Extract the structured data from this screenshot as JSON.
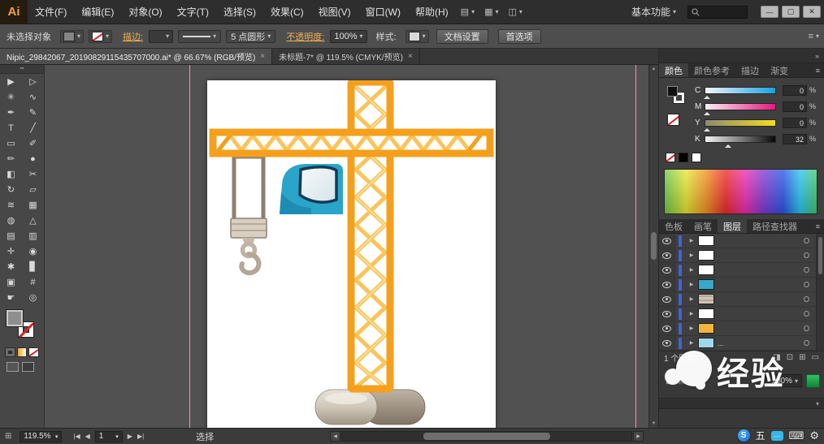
{
  "colors": {
    "accent_orange": "#F4A01C",
    "lattice_yellow": "#FAC45B",
    "cab_blue": "#2AA4C9",
    "hook_brown": "#8E8070",
    "guide_pink": "#EF93A6",
    "layer_bar_blue": "#3F63D8"
  },
  "menubar": {
    "logo": "Ai",
    "menus": [
      "文件(F)",
      "编辑(E)",
      "对象(O)",
      "文字(T)",
      "选择(S)",
      "效果(C)",
      "视图(V)",
      "窗口(W)",
      "帮助(H)"
    ],
    "workspace": "基本功能",
    "window_buttons": {
      "minimize": "—",
      "restore": "▢",
      "close": "✕"
    }
  },
  "controlbar": {
    "no_selection": "未选择对象",
    "stroke_label": "描边:",
    "stroke_value": "",
    "brush_name": "5 点圆形",
    "opacity_label": "不透明度:",
    "opacity_value": "100%",
    "style_label": "样式:",
    "doc_setup_button": "文档设置",
    "preferences_button": "首选项"
  },
  "tabbar": {
    "tabs": [
      {
        "title": "Nipic_29842067_20190829115435707000.ai* @ 66.67% (RGB/预览)",
        "close": "×"
      },
      {
        "title": "未标题-7* @ 119.5% (CMYK/预览)",
        "close": "×"
      }
    ]
  },
  "toolbar": {
    "tools": [
      {
        "name": "selection",
        "glyph": "▶"
      },
      {
        "name": "direct-selection",
        "glyph": "▷"
      },
      {
        "name": "magic-wand",
        "glyph": "✳"
      },
      {
        "name": "lasso",
        "glyph": "∿"
      },
      {
        "name": "pen",
        "glyph": "✒"
      },
      {
        "name": "curvature",
        "glyph": "✎"
      },
      {
        "name": "type",
        "glyph": "T"
      },
      {
        "name": "line-segment",
        "glyph": "╱"
      },
      {
        "name": "rectangle",
        "glyph": "▭"
      },
      {
        "name": "paintbrush",
        "glyph": "✐"
      },
      {
        "name": "pencil",
        "glyph": "✏"
      },
      {
        "name": "blob-brush",
        "glyph": "●"
      },
      {
        "name": "eraser",
        "glyph": "◧"
      },
      {
        "name": "scissors",
        "glyph": "✂"
      },
      {
        "name": "rotate",
        "glyph": "↻"
      },
      {
        "name": "scale",
        "glyph": "▱"
      },
      {
        "name": "width",
        "glyph": "≋"
      },
      {
        "name": "free-transform",
        "glyph": "▦"
      },
      {
        "name": "shape-builder",
        "glyph": "◍"
      },
      {
        "name": "perspective-grid",
        "glyph": "△"
      },
      {
        "name": "mesh",
        "glyph": "▤"
      },
      {
        "name": "gradient",
        "glyph": "▥"
      },
      {
        "name": "eyedropper",
        "glyph": "✛"
      },
      {
        "name": "blend",
        "glyph": "◉"
      },
      {
        "name": "symbol-sprayer",
        "glyph": "✱"
      },
      {
        "name": "column-graph",
        "glyph": "▊"
      },
      {
        "name": "artboard",
        "glyph": "▣"
      },
      {
        "name": "slice",
        "glyph": "#"
      },
      {
        "name": "hand",
        "glyph": "☛"
      },
      {
        "name": "zoom",
        "glyph": "◎"
      }
    ]
  },
  "color_panel": {
    "tabs": [
      "颜色",
      "颜色参考",
      "描边",
      "渐变"
    ],
    "channels": [
      {
        "label": "C",
        "value": "0"
      },
      {
        "label": "M",
        "value": "0"
      },
      {
        "label": "Y",
        "value": "0"
      },
      {
        "label": "K",
        "value": "32"
      }
    ],
    "percent": "%"
  },
  "layers_panel": {
    "tabs": [
      "色板",
      "画笔",
      "图层",
      "路径查找器"
    ],
    "rows": [
      {
        "thumb_style": "background:#ffffff"
      },
      {
        "thumb_style": "background:#ffffff"
      },
      {
        "thumb_style": "background:#ffffff"
      },
      {
        "thumb_style": "background:#35a9c9"
      },
      {
        "thumb_style": "background:repeating-linear-gradient(0deg,#cfc5b6 0 3px,#b2a795 3px 5px)"
      },
      {
        "thumb_style": "background:#ffffff"
      },
      {
        "thumb_style": "background:#f2b63a"
      },
      {
        "thumb_style": "background:#9fd8e8",
        "label": "..."
      }
    ],
    "footer": "1 个图层",
    "footer_icons": [
      {
        "name": "make-clip-mask",
        "glyph": "◨"
      },
      {
        "name": "new-sublayer",
        "glyph": "⊡"
      },
      {
        "name": "new-layer",
        "glyph": "⊞"
      },
      {
        "name": "delete-layer",
        "glyph": "▭"
      }
    ]
  },
  "extra_panel": {
    "value": "100%"
  },
  "statusbar": {
    "zoom": "119.5%",
    "page": "1",
    "mode": "选择",
    "nav": {
      "first": "|◀",
      "prev": "◀",
      "next": "▶",
      "last": "▶|"
    }
  },
  "taskbar": {
    "sogou": "S",
    "wubi": "五",
    "bubble_dots": "…"
  },
  "watermark": {
    "text": "经验"
  }
}
